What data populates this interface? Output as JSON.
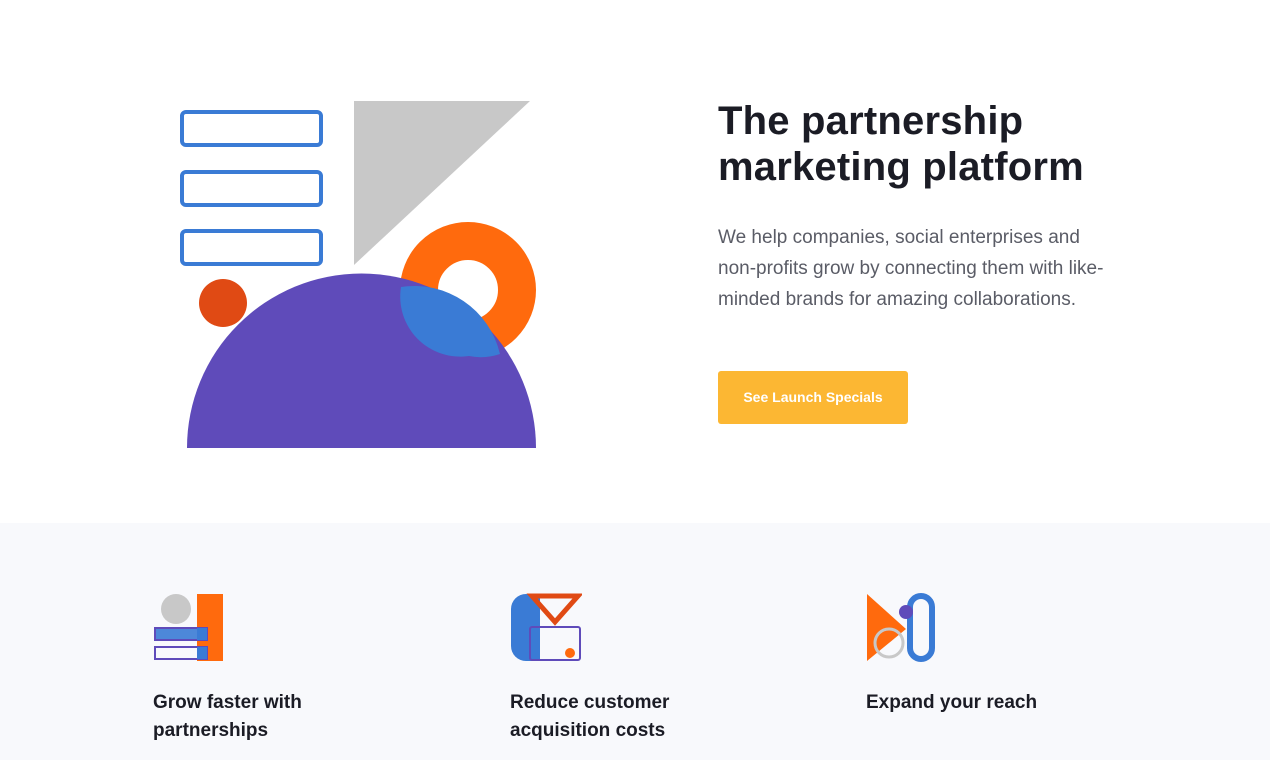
{
  "hero": {
    "title_line1": "The partnership",
    "title_line2": "marketing platform",
    "description": "We help companies, social enterprises and non-profits grow by connecting them with like-minded brands for amazing collaborations.",
    "cta_label": "See Launch Specials"
  },
  "features": [
    {
      "title": "Grow faster with partnerships",
      "icon": "grow-partnerships-icon"
    },
    {
      "title": "Reduce customer acquisition costs",
      "icon": "reduce-costs-icon"
    },
    {
      "title": "Expand your reach",
      "icon": "expand-reach-icon"
    }
  ],
  "colors": {
    "accent_yellow": "#fcb733",
    "blue": "#3a7bd5",
    "orange": "#ff6a0d",
    "purple": "#5f4bba",
    "red_orange": "#e04a14",
    "gray": "#c8c8c8",
    "features_bg": "#f8f9fc"
  }
}
